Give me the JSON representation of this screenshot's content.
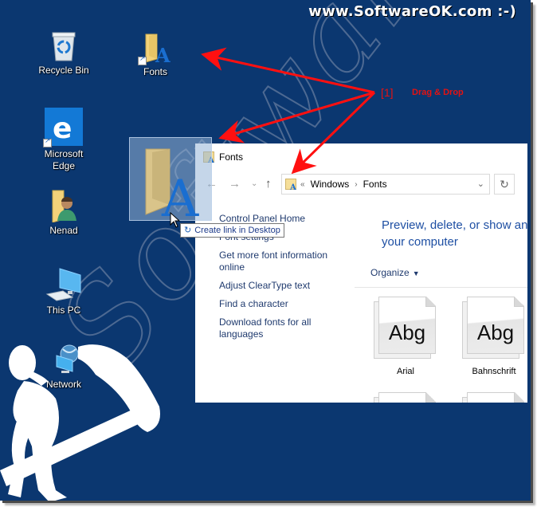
{
  "banner": {
    "text": "www.SoftwareOK.com :-)"
  },
  "watermark": {
    "text": "SoftwareOK.com"
  },
  "desktop": {
    "background_color": "#0b3770",
    "icons": [
      {
        "name": "recycle-bin",
        "label": "Recycle Bin",
        "icon": "recycle-bin-icon"
      },
      {
        "name": "fonts-shortcut",
        "label": "Fonts",
        "icon": "fonts-folder-icon",
        "shortcut": true
      },
      {
        "name": "microsoft-edge",
        "label": "Microsoft Edge",
        "icon": "edge-icon",
        "shortcut": true
      },
      {
        "name": "nenad",
        "label": "Nenad",
        "icon": "user-folder-icon"
      },
      {
        "name": "this-pc",
        "label": "This PC",
        "icon": "computer-icon"
      },
      {
        "name": "network",
        "label": "Network",
        "icon": "network-icon"
      }
    ]
  },
  "annotation": {
    "marker": "[1]",
    "text": "Drag & Drop",
    "color": "#e41212"
  },
  "drag": {
    "tooltip": "Create link in Desktop"
  },
  "explorer": {
    "title": "Fonts",
    "address": {
      "overflow": "«",
      "crumbs": [
        "Windows",
        "Fonts"
      ]
    },
    "left_links": [
      "Control Panel Home",
      "Font settings",
      "Get more font information online",
      "Adjust ClearType text",
      "Find a character",
      "Download fonts for all languages"
    ],
    "headline_line1": "Preview, delete, or show an",
    "headline_line2": "your computer",
    "organize_label": "Organize",
    "fonts": [
      {
        "sample": "Abg",
        "name": "Arial"
      },
      {
        "sample": "Abg",
        "name": "Bahnschrift"
      }
    ]
  }
}
